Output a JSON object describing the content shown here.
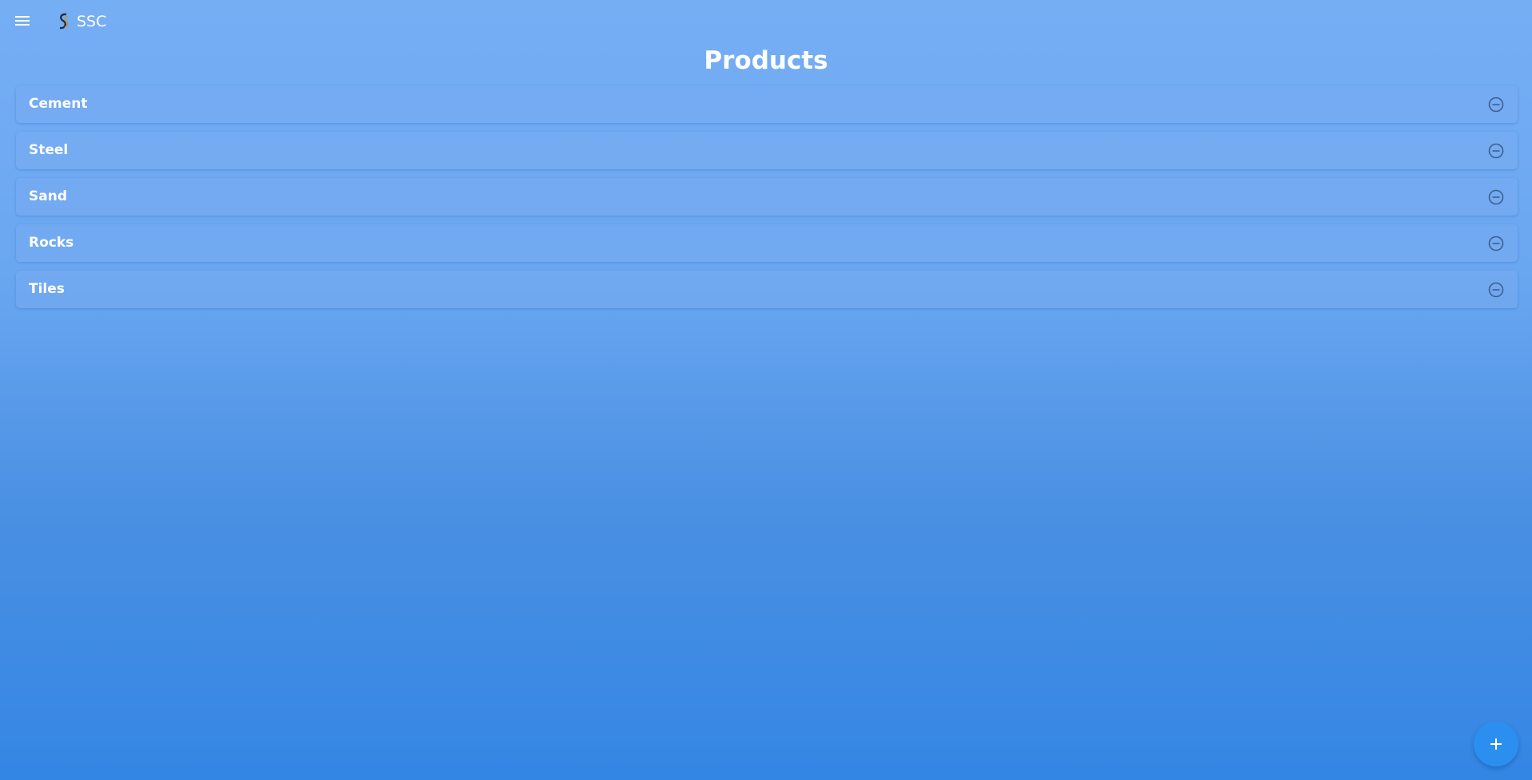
{
  "app": {
    "brand_name": "SSC",
    "brand_logo_text": "SSC"
  },
  "icons": {
    "menu": "menu-icon",
    "remove": "minus-circle-icon",
    "add": "plus-icon"
  },
  "page": {
    "title": "Products"
  },
  "products": [
    {
      "label": "Cement"
    },
    {
      "label": "Steel"
    },
    {
      "label": "Sand"
    },
    {
      "label": "Rocks"
    },
    {
      "label": "Tiles"
    }
  ],
  "colors": {
    "background_top": "#76aef4",
    "background_bottom": "#3486e4",
    "fab": "#2b8ff0",
    "remove_icon": "#3d5f8e"
  }
}
